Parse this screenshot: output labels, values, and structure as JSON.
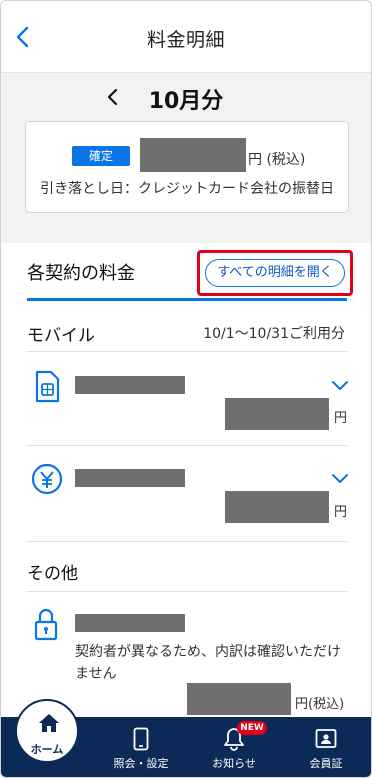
{
  "header": {
    "title": "料金明細",
    "back_icon": "chevron-left-icon"
  },
  "month_nav": {
    "label": "10月分",
    "prev_icon": "chevron-left-icon"
  },
  "summary": {
    "status_badge": "確定",
    "amount_unit": "円 (税込)",
    "withdrawal": "引き落とし日：クレジットカード会社の振替日"
  },
  "charges": {
    "heading": "各契約の料金",
    "open_all_label": "すべての明細を開く"
  },
  "mobile": {
    "label": "モバイル",
    "period": "10/1〜10/31ご利用分",
    "items": [
      {
        "icon": "sim-card-icon",
        "unit": "円"
      },
      {
        "icon": "yen-coin-icon",
        "unit": "円"
      }
    ]
  },
  "other": {
    "label": "その他",
    "icon": "lock-icon",
    "note": "契約者が異なるため、内訳は確認いただけません",
    "unit": "円(税込)"
  },
  "bottom_nav": {
    "items": [
      {
        "label": "ホーム",
        "icon": "home-icon"
      },
      {
        "label": "照会・設定",
        "icon": "smartphone-icon"
      },
      {
        "label": "お知らせ",
        "icon": "bell-icon",
        "badge": "NEW"
      },
      {
        "label": "会員証",
        "icon": "member-card-icon"
      }
    ]
  },
  "colors": {
    "accent": "#0a75e6",
    "highlight": "#e1001a",
    "nav_background": "#0c2a58",
    "redaction": "#6f6f6f"
  }
}
